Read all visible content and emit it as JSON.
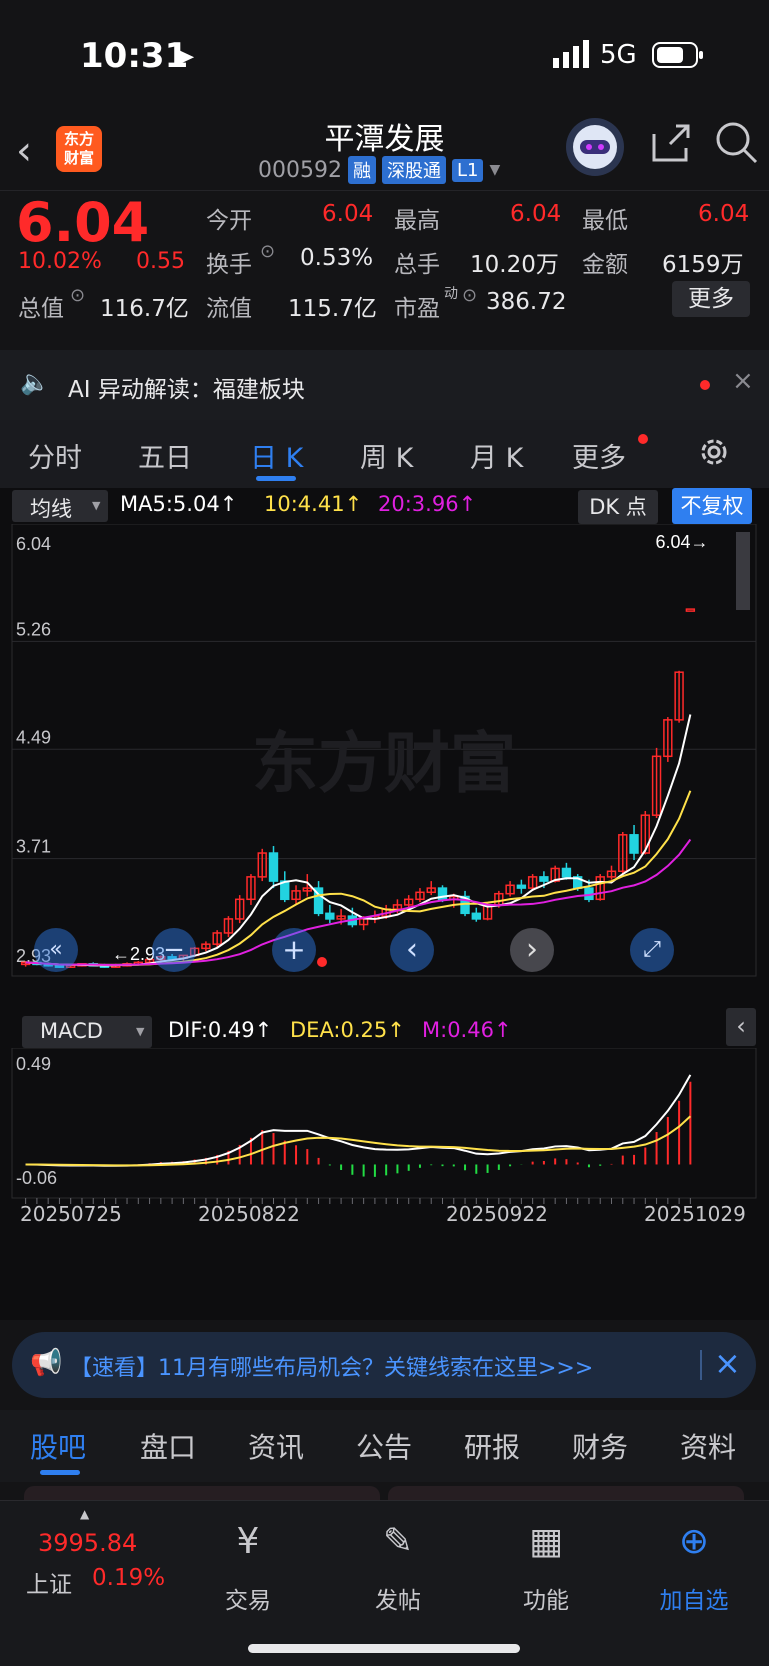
{
  "status_bar": {
    "time": "10:31",
    "network": "5G"
  },
  "header": {
    "title": "平潭发展",
    "code": "000592",
    "tags": [
      "融",
      "深股通",
      "L1"
    ],
    "logo_text": "东方财富"
  },
  "quote": {
    "price": "6.04",
    "change_pct": "10.02%",
    "change": "0.55",
    "open_label": "今开",
    "open": "6.04",
    "high_label": "最高",
    "high": "6.04",
    "low_label": "最低",
    "low": "6.04",
    "turnover_label": "换手",
    "turnover": "0.53%",
    "volume_label": "总手",
    "volume": "10.20万",
    "amount_label": "金额",
    "amount": "6159万",
    "mktcap_label": "总值",
    "mktcap": "116.7亿",
    "float_label": "流值",
    "float": "115.7亿",
    "pe_label": "市盈",
    "pe_sup": "动",
    "pe": "386.72",
    "more": "更多"
  },
  "ai_bar": {
    "text": "AI 异动解读：福建板块"
  },
  "tabs": [
    "分时",
    "五日",
    "日 K",
    "周 K",
    "月 K",
    "更多"
  ],
  "active_tab": "日 K",
  "chart_toolbar": {
    "indicator": "均线",
    "ma5": "MA5:5.04",
    "ma10": "10:4.41",
    "ma20": "20:3.96",
    "dk": "DK 点",
    "adjust": "不复权"
  },
  "macd_toolbar": {
    "indicator": "MACD",
    "dif": "DIF:0.49",
    "dea": "DEA:0.25",
    "m": "M:0.46"
  },
  "watermark": "东方财富",
  "chart_data": {
    "type": "candlestick",
    "y_ticks": [
      "6.04",
      "5.26",
      "4.49",
      "3.71",
      "2.93"
    ],
    "ylim": [
      2.93,
      6.04
    ],
    "last_price_marker": "6.04",
    "low_marker": "2.93",
    "x_ticks": [
      "20250725",
      "20250822",
      "20250922",
      "20251029"
    ],
    "candles": [
      [
        2.96,
        2.98,
        2.94,
        2.97
      ],
      [
        2.97,
        2.97,
        2.95,
        2.96
      ],
      [
        2.96,
        2.97,
        2.94,
        2.95
      ],
      [
        2.95,
        2.96,
        2.93,
        2.94
      ],
      [
        2.94,
        2.96,
        2.93,
        2.95
      ],
      [
        2.95,
        2.96,
        2.94,
        2.96
      ],
      [
        2.96,
        2.97,
        2.95,
        2.95
      ],
      [
        2.95,
        2.96,
        2.93,
        2.94
      ],
      [
        2.94,
        2.96,
        2.94,
        2.95
      ],
      [
        2.95,
        2.97,
        2.94,
        2.96
      ],
      [
        2.96,
        2.98,
        2.95,
        2.97
      ],
      [
        2.97,
        3.0,
        2.96,
        2.99
      ],
      [
        2.99,
        3.02,
        2.98,
        3.01
      ],
      [
        3.01,
        3.03,
        2.99,
        3.0
      ],
      [
        3.0,
        3.02,
        2.98,
        3.02
      ],
      [
        3.02,
        3.08,
        3.01,
        3.07
      ],
      [
        3.07,
        3.12,
        3.05,
        3.1
      ],
      [
        3.1,
        3.2,
        3.08,
        3.18
      ],
      [
        3.18,
        3.3,
        3.15,
        3.28
      ],
      [
        3.28,
        3.45,
        3.25,
        3.42
      ],
      [
        3.42,
        3.6,
        3.38,
        3.58
      ],
      [
        3.58,
        3.78,
        3.55,
        3.75
      ],
      [
        3.75,
        3.8,
        3.5,
        3.55
      ],
      [
        3.55,
        3.62,
        3.4,
        3.42
      ],
      [
        3.42,
        3.52,
        3.38,
        3.48
      ],
      [
        3.48,
        3.6,
        3.44,
        3.5
      ],
      [
        3.5,
        3.55,
        3.3,
        3.32
      ],
      [
        3.32,
        3.38,
        3.25,
        3.28
      ],
      [
        3.28,
        3.35,
        3.24,
        3.3
      ],
      [
        3.3,
        3.36,
        3.22,
        3.24
      ],
      [
        3.24,
        3.3,
        3.2,
        3.28
      ],
      [
        3.28,
        3.34,
        3.25,
        3.3
      ],
      [
        3.3,
        3.38,
        3.28,
        3.35
      ],
      [
        3.35,
        3.42,
        3.32,
        3.38
      ],
      [
        3.38,
        3.45,
        3.35,
        3.42
      ],
      [
        3.42,
        3.5,
        3.4,
        3.47
      ],
      [
        3.47,
        3.55,
        3.45,
        3.5
      ],
      [
        3.5,
        3.52,
        3.4,
        3.42
      ],
      [
        3.42,
        3.46,
        3.36,
        3.44
      ],
      [
        3.44,
        3.48,
        3.3,
        3.32
      ],
      [
        3.32,
        3.36,
        3.26,
        3.28
      ],
      [
        3.28,
        3.4,
        3.27,
        3.38
      ],
      [
        3.38,
        3.48,
        3.36,
        3.46
      ],
      [
        3.46,
        3.55,
        3.44,
        3.52
      ],
      [
        3.52,
        3.56,
        3.46,
        3.5
      ],
      [
        3.5,
        3.6,
        3.48,
        3.58
      ],
      [
        3.58,
        3.62,
        3.5,
        3.55
      ],
      [
        3.55,
        3.66,
        3.54,
        3.64
      ],
      [
        3.64,
        3.68,
        3.56,
        3.58
      ],
      [
        3.58,
        3.6,
        3.48,
        3.5
      ],
      [
        3.5,
        3.56,
        3.4,
        3.42
      ],
      [
        3.42,
        3.6,
        3.41,
        3.58
      ],
      [
        3.58,
        3.66,
        3.56,
        3.62
      ],
      [
        3.62,
        3.9,
        3.6,
        3.88
      ],
      [
        3.88,
        3.95,
        3.7,
        3.75
      ],
      [
        3.75,
        4.05,
        3.74,
        4.02
      ],
      [
        4.02,
        4.5,
        4.0,
        4.44
      ],
      [
        4.44,
        4.72,
        4.4,
        4.7
      ],
      [
        4.7,
        5.05,
        4.68,
        5.04
      ],
      [
        5.49,
        5.49,
        5.49,
        5.49
      ]
    ],
    "ma5_label": "MA5",
    "ma10_label": "10",
    "ma20_label": "20",
    "macd": {
      "y_ticks": [
        "0.49",
        "-0.06"
      ],
      "ylim": [
        -0.06,
        0.49
      ],
      "dif_label": "DIF",
      "dea_label": "DEA",
      "m_label": "M"
    }
  },
  "news_banner": {
    "text": "【速看】11月有哪些布局机会？关键线索在这里>>>"
  },
  "bottom_tabs": [
    "股吧",
    "盘口",
    "资讯",
    "公告",
    "研报",
    "财务",
    "资料"
  ],
  "bottom_active": "股吧",
  "bottom_bar": {
    "index_value": "3995.84",
    "index_name": "上证",
    "index_change": "0.19%",
    "items": [
      "交易",
      "发帖",
      "功能",
      "加自选"
    ]
  },
  "colors": {
    "up": "#ff2a2a",
    "down": "#22d3e0",
    "ma5": "#ffffff",
    "ma10": "#ffe14a",
    "ma20": "#e020e0",
    "accent": "#2f7ff0"
  }
}
